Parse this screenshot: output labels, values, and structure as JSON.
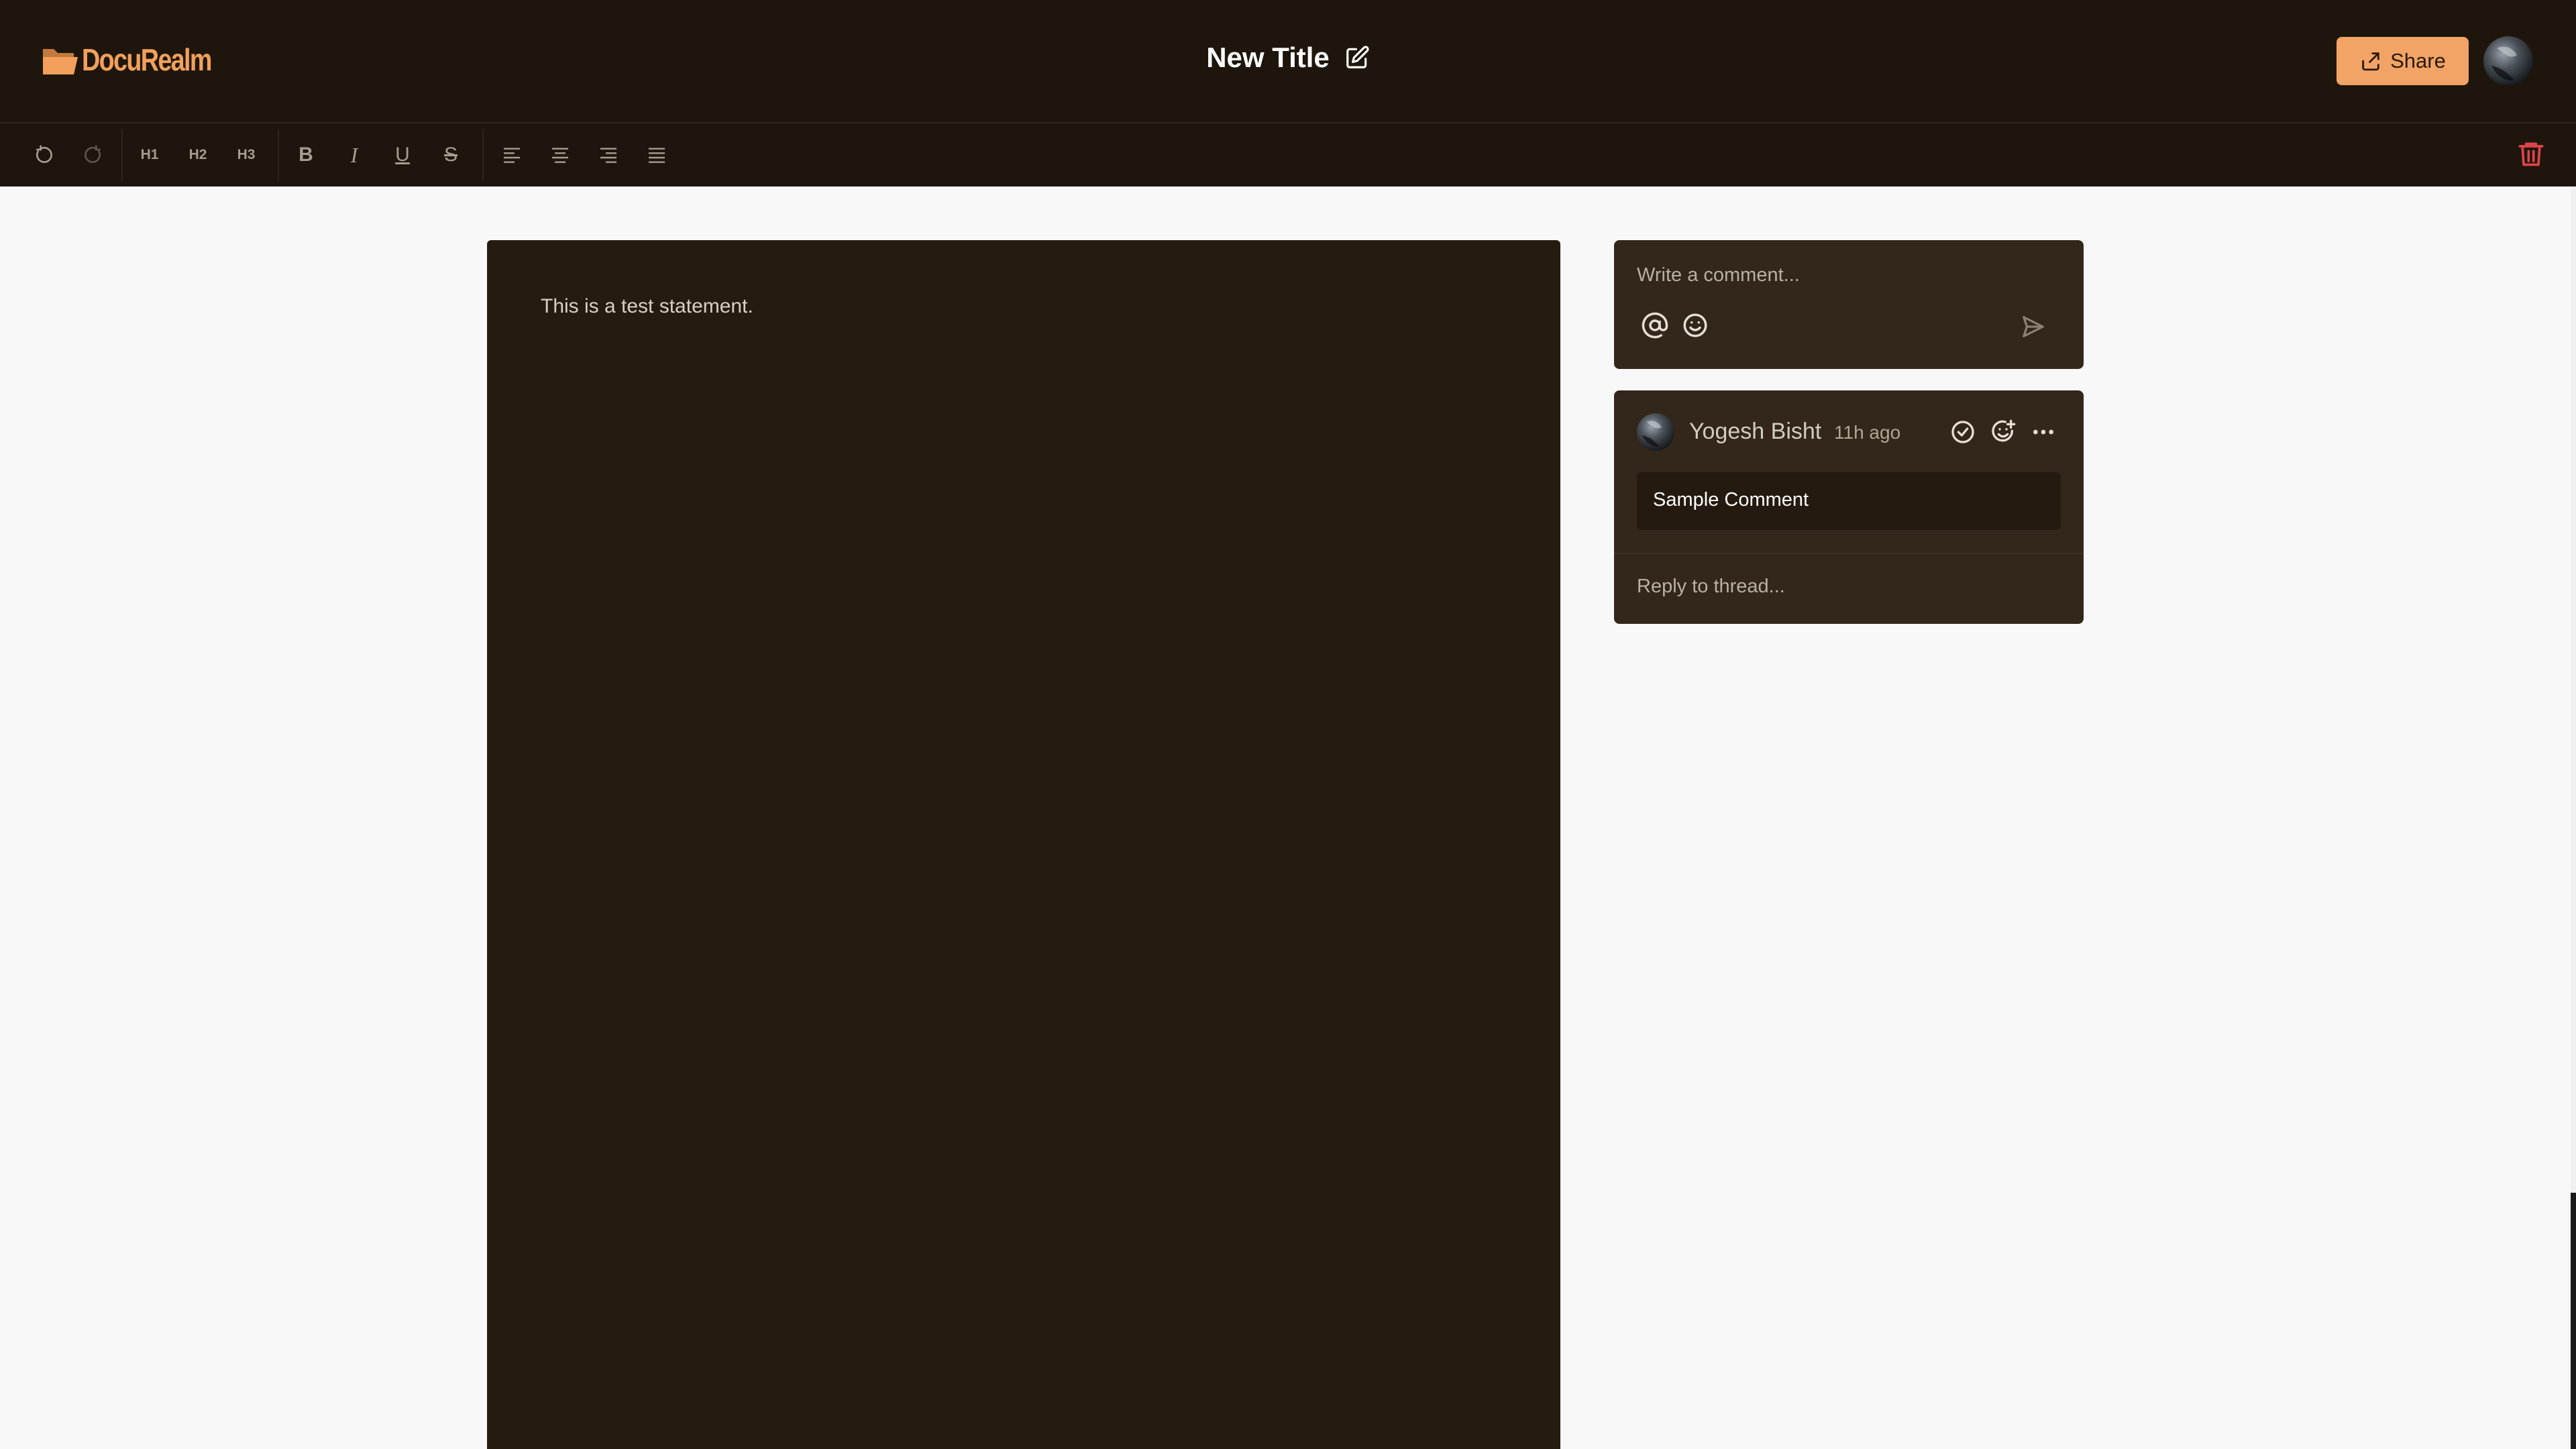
{
  "app": {
    "logo_text": "DocuRealm",
    "doc_title": "New Title",
    "share_label": "Share",
    "colors": {
      "header_bg": "#1e160c",
      "accent": "#f2a366",
      "page_bg": "#261b10",
      "panel_bg": "#32271a",
      "danger": "#e0444b"
    }
  },
  "toolbar": {
    "undo_icon": "undo-icon",
    "redo_icon": "redo-icon",
    "h1_label": "H1",
    "h2_label": "H2",
    "h3_label": "H3",
    "bold_label": "B",
    "italic_label": "I",
    "underline_label": "U",
    "strike_label": "S",
    "align_icons": [
      "align-left-icon",
      "align-center-icon",
      "align-right-icon",
      "align-justify-icon"
    ],
    "delete_icon": "trash-icon"
  },
  "document": {
    "body_text": "This is a test statement."
  },
  "comment_composer": {
    "placeholder": "Write a comment..."
  },
  "thread": {
    "author": "Yogesh Bisht",
    "time": "11h ago",
    "comment": "Sample Comment",
    "reply_placeholder": "Reply to thread..."
  }
}
